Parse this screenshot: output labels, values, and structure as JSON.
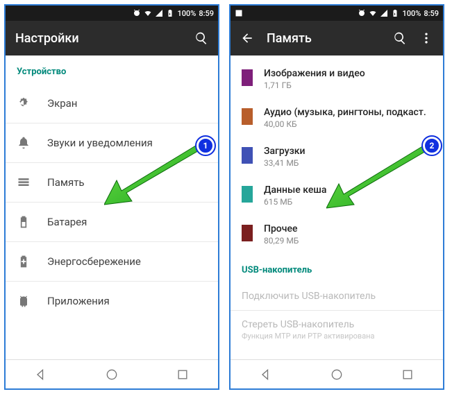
{
  "statusbar": {
    "battery": "100%",
    "clock": "8:59"
  },
  "phone1": {
    "appbar": {
      "title": "Настройки"
    },
    "section_device": "Устройство",
    "items": [
      {
        "label": "Экран"
      },
      {
        "label": "Звуки и уведомления"
      },
      {
        "label": "Память"
      },
      {
        "label": "Батарея"
      },
      {
        "label": "Энергосбережение"
      },
      {
        "label": "Приложения"
      }
    ]
  },
  "phone2": {
    "appbar": {
      "title": "Память"
    },
    "categories": [
      {
        "label": "Изображения и видео",
        "value": "1,71 ГБ",
        "color": "#7e1f7a"
      },
      {
        "label": "Аудио (музыка, рингтоны, подкаст.",
        "value": "40,00 КБ",
        "color": "#b85e2b"
      },
      {
        "label": "Загрузки",
        "value": "33,41 МБ",
        "color": "#3f51b5"
      },
      {
        "label": "Данные кеша",
        "value": "615 МБ",
        "color": "#26a69a"
      },
      {
        "label": "Прочее",
        "value": "80,29 МБ",
        "color": "#7b1f1f"
      }
    ],
    "usb_section": "USB-накопитель",
    "usb_items": [
      {
        "label": "Подключить USB-накопитель",
        "sub": ""
      },
      {
        "label": "Стереть USB-накопитель",
        "sub": "Функция MTP или PTP активирована"
      }
    ]
  },
  "annotations": {
    "badge1": "1",
    "badge2": "2"
  }
}
